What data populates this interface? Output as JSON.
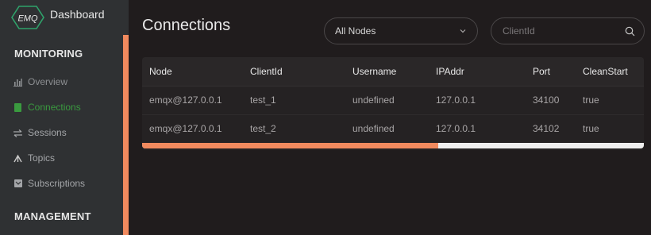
{
  "app": {
    "logo_text": "EMQ",
    "title": "Dashboard",
    "accent_color": "#f18a5e",
    "active_color": "#3a9a3f"
  },
  "sidebar": {
    "sections": [
      {
        "label": "MONITORING",
        "items": [
          {
            "label": "Overview",
            "icon": "bar-chart-icon",
            "active": false
          },
          {
            "label": "Connections",
            "icon": "document-icon",
            "active": true
          },
          {
            "label": "Sessions",
            "icon": "swap-arrows-icon",
            "active": false
          },
          {
            "label": "Topics",
            "icon": "branch-icon",
            "active": false
          },
          {
            "label": "Subscriptions",
            "icon": "message-icon",
            "active": false
          }
        ]
      },
      {
        "label": "MANAGEMENT",
        "items": []
      }
    ]
  },
  "main": {
    "title": "Connections",
    "node_select": {
      "value": "All Nodes",
      "icon": "chevron-down-icon"
    },
    "search": {
      "placeholder": "ClientId",
      "value": "",
      "icon": "search-icon"
    },
    "table": {
      "columns": [
        "Node",
        "ClientId",
        "Username",
        "IPAddr",
        "Port",
        "CleanStart"
      ],
      "rows": [
        [
          "emqx@127.0.0.1",
          "test_1",
          "undefined",
          "127.0.0.1",
          "34100",
          "true"
        ],
        [
          "emqx@127.0.0.1",
          "test_2",
          "undefined",
          "127.0.0.1",
          "34102",
          "true"
        ]
      ],
      "horizontal_scroll_fraction": 0.59
    }
  }
}
